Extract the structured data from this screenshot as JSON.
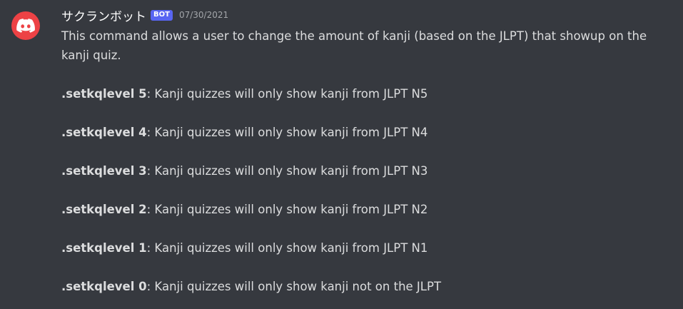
{
  "message": {
    "author": "サクランボット",
    "bot_tag": "BOT",
    "timestamp": "07/30/2021",
    "intro": "This command allows a user to change the amount of kanji (based on the JLPT) that showup on the kanji quiz.",
    "commands": [
      {
        "command": ".setkqlevel 5",
        "description": ": Kanji quizzes will only show kanji from JLPT N5"
      },
      {
        "command": ".setkqlevel 4",
        "description": ": Kanji quizzes will only show kanji from JLPT N4"
      },
      {
        "command": ".setkqlevel 3",
        "description": ": Kanji quizzes will only show kanji from JLPT N3"
      },
      {
        "command": ".setkqlevel 2",
        "description": ": Kanji quizzes will only show kanji from JLPT N2"
      },
      {
        "command": ".setkqlevel 1",
        "description": ": Kanji quizzes will only show kanji from JLPT N1"
      },
      {
        "command": ".setkqlevel 0",
        "description": ": Kanji quizzes will only show kanji not on the JLPT"
      }
    ]
  },
  "icons": {
    "avatar": "discord-logo-icon"
  },
  "colors": {
    "background": "#36393f",
    "avatar": "#ed4245",
    "bot_tag": "#5865f2",
    "text": "#dcddde",
    "timestamp": "#a3a6aa"
  }
}
